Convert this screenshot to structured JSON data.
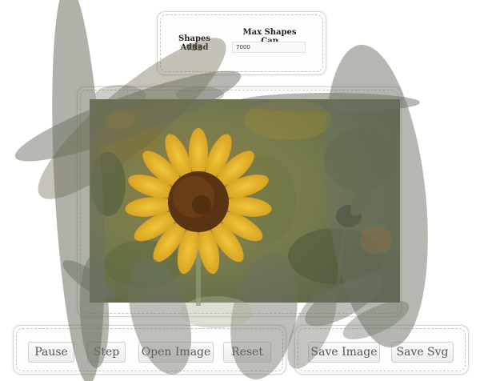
{
  "stats": {
    "shapes_added_label": "Shapes Added",
    "shapes_added_value": "753",
    "max_cap_label": "Max Shapes Cap",
    "max_cap_value": "7000"
  },
  "controls": {
    "pause_label": "Pause",
    "step_label": "Step",
    "open_image_label": "Open Image",
    "reset_label": "Reset",
    "save_image_label": "Save Image",
    "save_svg_label": "Save Svg"
  },
  "canvas": {
    "subject": "sunflower painting",
    "palette": {
      "background": "#5f6a45",
      "petal": "#e8b82a",
      "center": "#5a3312",
      "stroke": "#6c7263"
    }
  }
}
